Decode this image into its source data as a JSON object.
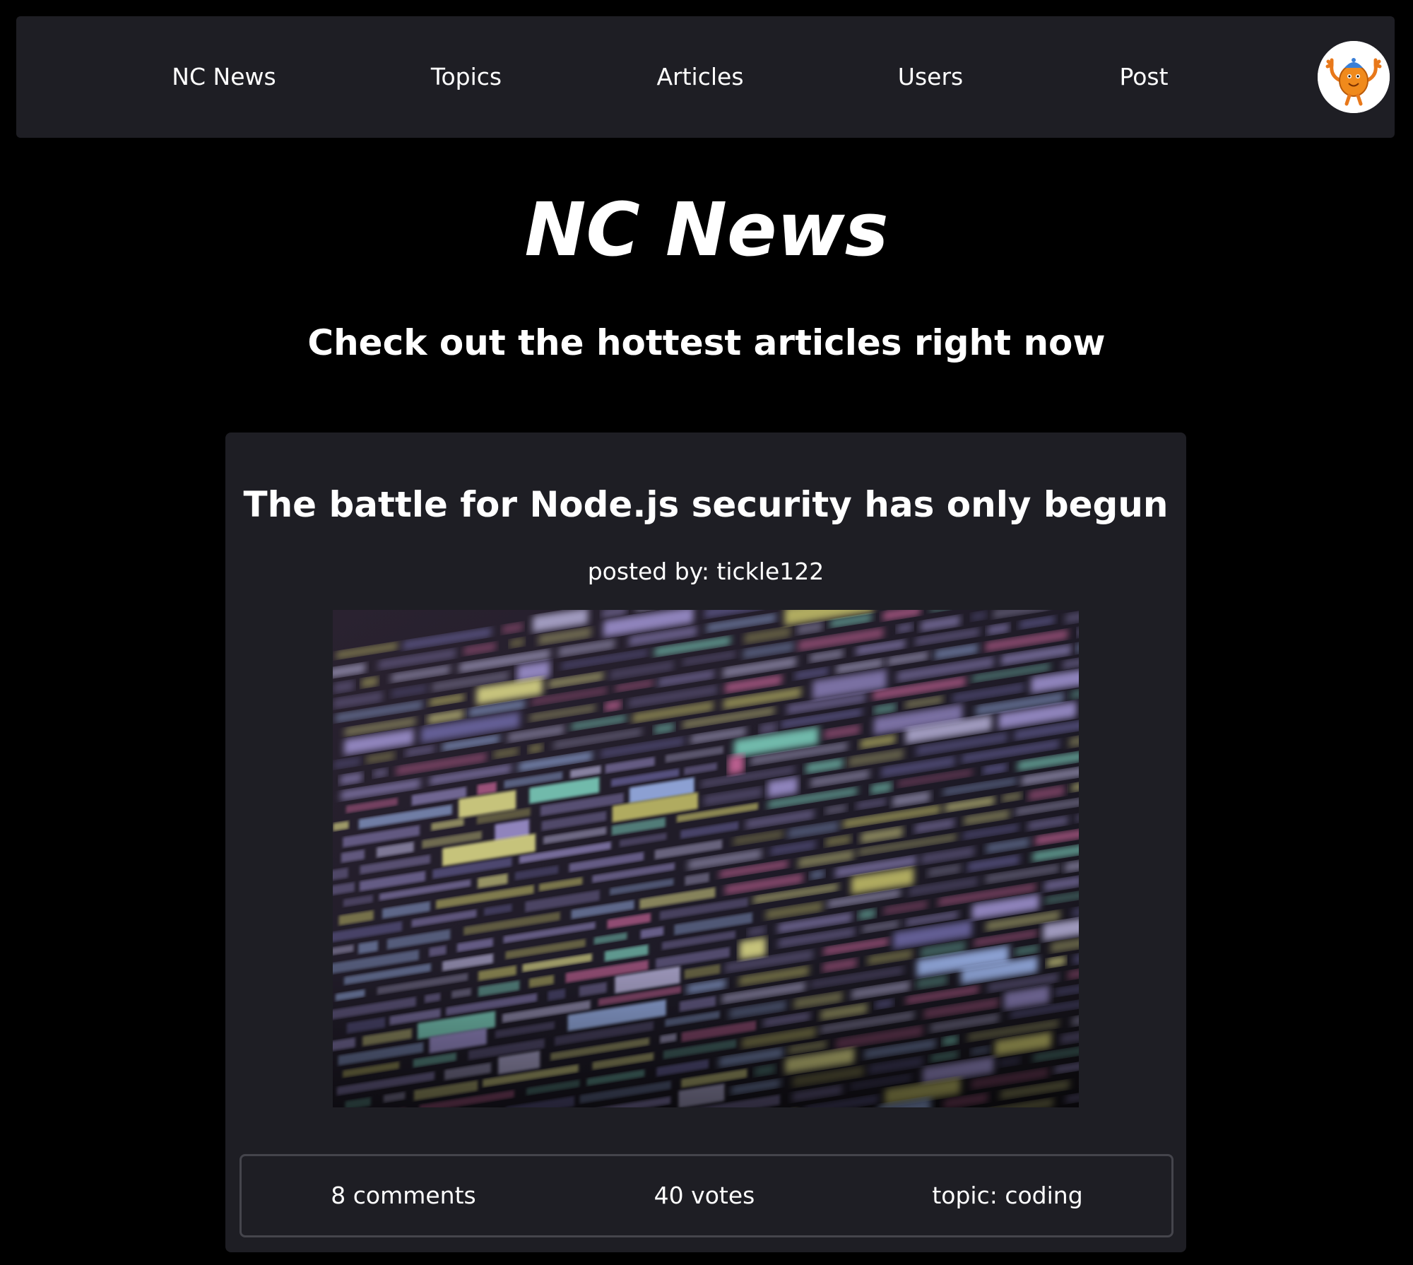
{
  "nav": {
    "items": [
      {
        "label": "NC News"
      },
      {
        "label": "Topics"
      },
      {
        "label": "Articles"
      },
      {
        "label": "Users"
      },
      {
        "label": "Post"
      }
    ],
    "avatar_icon": "orange-cartoon-character-avatar"
  },
  "hero": {
    "title": "NC News",
    "subtitle": "Check out the hottest articles right now"
  },
  "article": {
    "title": "The battle for Node.js security has only begun",
    "posted_by": "posted by: tickle122",
    "image_icon": "code-on-screen-photo",
    "comments": "8 comments",
    "votes": "40 votes",
    "topic": "topic: coding"
  },
  "colors": {
    "background": "#000000",
    "panel": "#1e1e24",
    "text": "#ffffff",
    "border": "#45454c"
  }
}
